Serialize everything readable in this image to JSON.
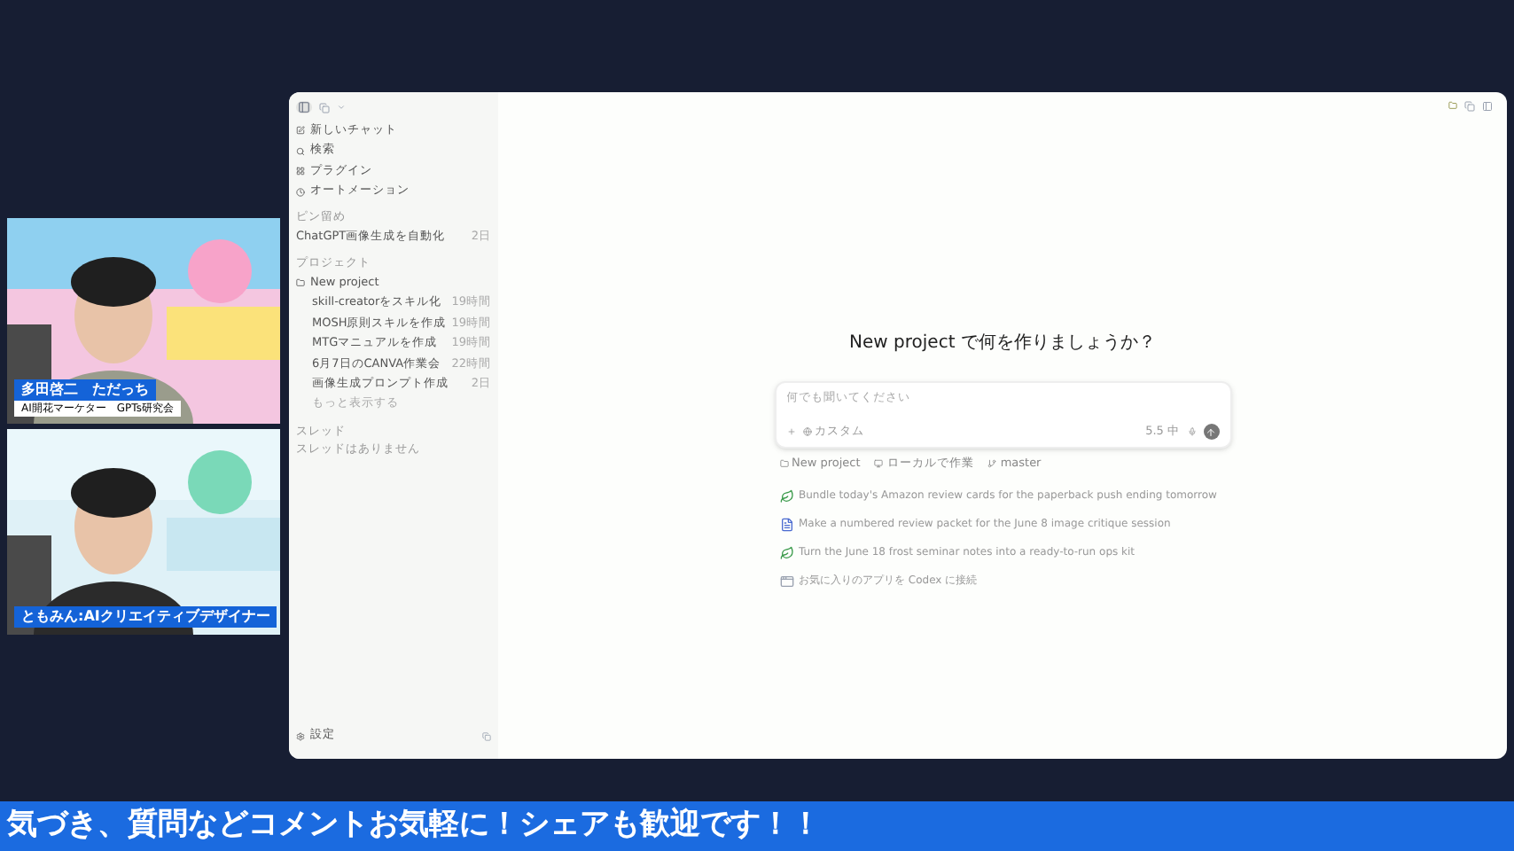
{
  "webcams": [
    {
      "kind": "picture",
      "name": "多田啓二　ただっち",
      "role": "AI開花マーケター　GPTs研究会"
    },
    {
      "kind": "picture",
      "name": "ともみん:AIクリエイティブデザイナー"
    }
  ],
  "sidebar": {
    "nav": [
      {
        "label": "新しいチャット"
      },
      {
        "label": "検索"
      },
      {
        "label": "プラグイン"
      },
      {
        "label": "オートメーション"
      }
    ],
    "pinned_heading": "ピン留め",
    "pinned": [
      {
        "label": "ChatGPT画像生成を自動化",
        "time": "2日"
      }
    ],
    "projects_heading": "プロジェクト",
    "project": "New project",
    "threads": [
      {
        "label": "skill-creatorをスキル化",
        "time": "19時間"
      },
      {
        "label": "MOSH原則スキルを作成",
        "time": "19時間"
      },
      {
        "label": "MTGマニュアルを作成",
        "time": "19時間"
      },
      {
        "label": "6月7日のCANVA作業会",
        "time": "22時間"
      },
      {
        "label": "画像生成プロンプト作成",
        "time": "2日"
      }
    ],
    "more": "もっと表示する",
    "chats_heading": "スレッド",
    "chats_empty": "スレッドはありません",
    "settings": "設定"
  },
  "main": {
    "title": "New project で何を作りましょうか？",
    "composer": {
      "placeholder": "何でも聞いてください",
      "mode": "カスタム",
      "model": "5.5 中"
    },
    "context": [
      "New project",
      "ローカルで作業",
      "master"
    ],
    "suggestions": [
      {
        "kind": "leaf",
        "text": "Bundle today's Amazon review cards for the paperback push ending tomorrow"
      },
      {
        "kind": "doc",
        "text": "Make a numbered review packet for the June 8 image critique session"
      },
      {
        "kind": "leaf",
        "text": "Turn the June 18 frost seminar notes into a ready-to-run ops kit"
      },
      {
        "kind": "app",
        "text": "お気に入りのアプリを Codex に接続"
      }
    ]
  },
  "banner": "気づき、質問などコメントお気軽に！シェアも歓迎です！！"
}
